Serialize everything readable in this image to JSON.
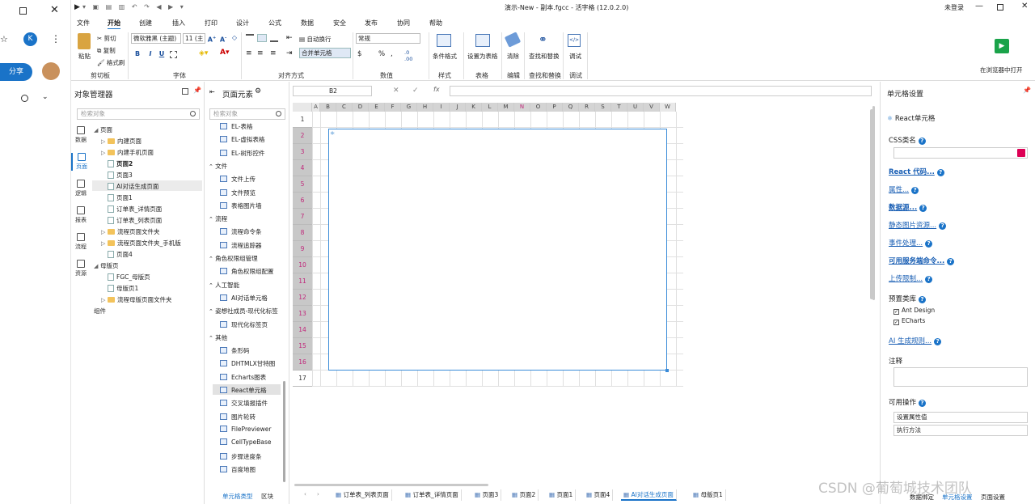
{
  "browser": {
    "share_label": "分享",
    "profile_initial": "K"
  },
  "titlebar": {
    "title": "演示-New - 副本.fgcc - 活字格 (12.0.2.0)",
    "login": "未登录"
  },
  "menu": [
    "文件",
    "开始",
    "创建",
    "插入",
    "打印",
    "设计",
    "公式",
    "数据",
    "安全",
    "发布",
    "协同",
    "帮助"
  ],
  "ribbon": {
    "clipboard": {
      "paste": "粘贴",
      "cut": "剪切",
      "copy": "复制",
      "format_painter": "格式刷",
      "group": "剪切板"
    },
    "font": {
      "family": "微软雅黑 (主题)",
      "size": "11 (主",
      "group": "字体",
      "bold": "B",
      "italic": "I",
      "underline": "U"
    },
    "align": {
      "wrap": "自动换行",
      "merge": "合并单元格",
      "group": "对齐方式"
    },
    "number": {
      "format": "常规",
      "currency": "$",
      "percent": "%",
      "comma": ",",
      "group": "数值"
    },
    "style": {
      "conditional": "条件格式",
      "group": "样式"
    },
    "table": {
      "set_table": "设置为表格",
      "group": "表格"
    },
    "edit": {
      "clear": "清除",
      "group": "编辑"
    },
    "find": {
      "find_replace": "查找和替换",
      "group": "查找和替换"
    },
    "debug": {
      "debug": "调试",
      "group": "调试"
    },
    "open_browser": "在浏览器中打开"
  },
  "object_manager": {
    "title": "对象管理器",
    "search_placeholder": "检索对象",
    "nav": [
      "数据",
      "页面",
      "逻辑",
      "报表",
      "流程",
      "资源"
    ],
    "tree": [
      {
        "label": "页面",
        "indent": 0,
        "type": "root"
      },
      {
        "label": "内建页面",
        "indent": 1,
        "type": "folder"
      },
      {
        "label": "内建手机页面",
        "indent": 1,
        "type": "folder"
      },
      {
        "label": "页面2",
        "indent": 1,
        "type": "page",
        "bold": true
      },
      {
        "label": "页面3",
        "indent": 1,
        "type": "page"
      },
      {
        "label": "AI对话生成页面",
        "indent": 1,
        "type": "page",
        "selected": true
      },
      {
        "label": "页面1",
        "indent": 1,
        "type": "page"
      },
      {
        "label": "订单表_详情页面",
        "indent": 1,
        "type": "page"
      },
      {
        "label": "订单表_列表页面",
        "indent": 1,
        "type": "page"
      },
      {
        "label": "流程页面文件夹",
        "indent": 1,
        "type": "folder"
      },
      {
        "label": "流程页面文件夹_手机版",
        "indent": 1,
        "type": "folder"
      },
      {
        "label": "页面4",
        "indent": 1,
        "type": "page"
      },
      {
        "label": "母版页",
        "indent": 0,
        "type": "root"
      },
      {
        "label": "FGC_母版页",
        "indent": 1,
        "type": "page"
      },
      {
        "label": "母版页1",
        "indent": 1,
        "type": "page"
      },
      {
        "label": "流程母版页面文件夹",
        "indent": 1,
        "type": "folder"
      },
      {
        "label": "组件",
        "indent": 0,
        "type": "plain"
      }
    ]
  },
  "page_elements": {
    "title": "页面元素",
    "search_placeholder": "检索对象",
    "items": [
      {
        "kind": "item",
        "label": "EL-表格"
      },
      {
        "kind": "item",
        "label": "EL-虚拟表格"
      },
      {
        "kind": "item",
        "label": "EL-树形控件"
      },
      {
        "kind": "sec",
        "label": "文件"
      },
      {
        "kind": "item",
        "label": "文件上传"
      },
      {
        "kind": "item",
        "label": "文件预览"
      },
      {
        "kind": "item",
        "label": "表格图片墙"
      },
      {
        "kind": "sec",
        "label": "流程"
      },
      {
        "kind": "item",
        "label": "流程命令条"
      },
      {
        "kind": "item",
        "label": "流程追踪器"
      },
      {
        "kind": "sec",
        "label": "角色权限组管理"
      },
      {
        "kind": "item",
        "label": "角色权限组配置"
      },
      {
        "kind": "sec",
        "label": "人工智能"
      },
      {
        "kind": "item",
        "label": "AI对话单元格"
      },
      {
        "kind": "sec",
        "label": "姿想社成员-现代化标签"
      },
      {
        "kind": "item",
        "label": "现代化标签页"
      },
      {
        "kind": "sec",
        "label": "其他"
      },
      {
        "kind": "item",
        "label": "条形码"
      },
      {
        "kind": "item",
        "label": "DHTMLX甘特图"
      },
      {
        "kind": "item",
        "label": "Echarts图表"
      },
      {
        "kind": "item",
        "label": "React单元格",
        "selected": true
      },
      {
        "kind": "item",
        "label": "交叉填报插件"
      },
      {
        "kind": "item",
        "label": "图片轮转"
      },
      {
        "kind": "item",
        "label": "FilePreviewer"
      },
      {
        "kind": "item",
        "label": "CellTypeBase"
      },
      {
        "kind": "item",
        "label": "步骤进度条"
      },
      {
        "kind": "item",
        "label": "百度地图"
      }
    ],
    "bottom_tabs": [
      "单元格类型",
      "区块"
    ]
  },
  "formula_bar": {
    "cell": "B2",
    "fx": "fx"
  },
  "grid": {
    "columns": [
      "A",
      "B",
      "C",
      "D",
      "E",
      "F",
      "G",
      "H",
      "I",
      "J",
      "K",
      "L",
      "M",
      "N",
      "O",
      "P",
      "Q",
      "R",
      "S",
      "T",
      "U",
      "V",
      "W"
    ],
    "rows": [
      "1",
      "2",
      "3",
      "4",
      "5",
      "6",
      "7",
      "8",
      "9",
      "10",
      "11",
      "12",
      "13",
      "14",
      "15",
      "16",
      "17"
    ]
  },
  "sheet_tabs": [
    "订单表_列表页面",
    "订单表_详情页面",
    "页面3",
    "页面2",
    "页面1",
    "页面4",
    "AI对话生成页面",
    "母版页1"
  ],
  "active_sheet": "AI对话生成页面",
  "cell_settings": {
    "title": "单元格设置",
    "celltype": "React单元格",
    "css_label": "CSS类名",
    "links": [
      {
        "label": "React 代码...",
        "bold": true
      },
      {
        "label": "属性...",
        "bold": false
      },
      {
        "label": "数据源...",
        "bold": true
      },
      {
        "label": "静态图片资源...",
        "bold": false
      },
      {
        "label": "事件处理...",
        "bold": false
      },
      {
        "label": "可用服务端命令...",
        "bold": true
      },
      {
        "label": "上传限制...",
        "bold": false
      }
    ],
    "preset_label": "预置类库",
    "presets": [
      "Ant Design",
      "ECharts"
    ],
    "ai_rules": "AI 生成规则...",
    "note_label": "注释",
    "ops_label": "可用操作",
    "ops": [
      "设置属性值",
      "执行方法"
    ],
    "bottom_tabs": [
      "数据绑定",
      "单元格设置",
      "页面设置"
    ]
  },
  "watermark": "CSDN @葡萄城技术团队",
  "colors": {
    "accent": "#1a73c8",
    "grid_selection": "#3a8bd8",
    "row_header_selected": "#c8c8c8"
  }
}
